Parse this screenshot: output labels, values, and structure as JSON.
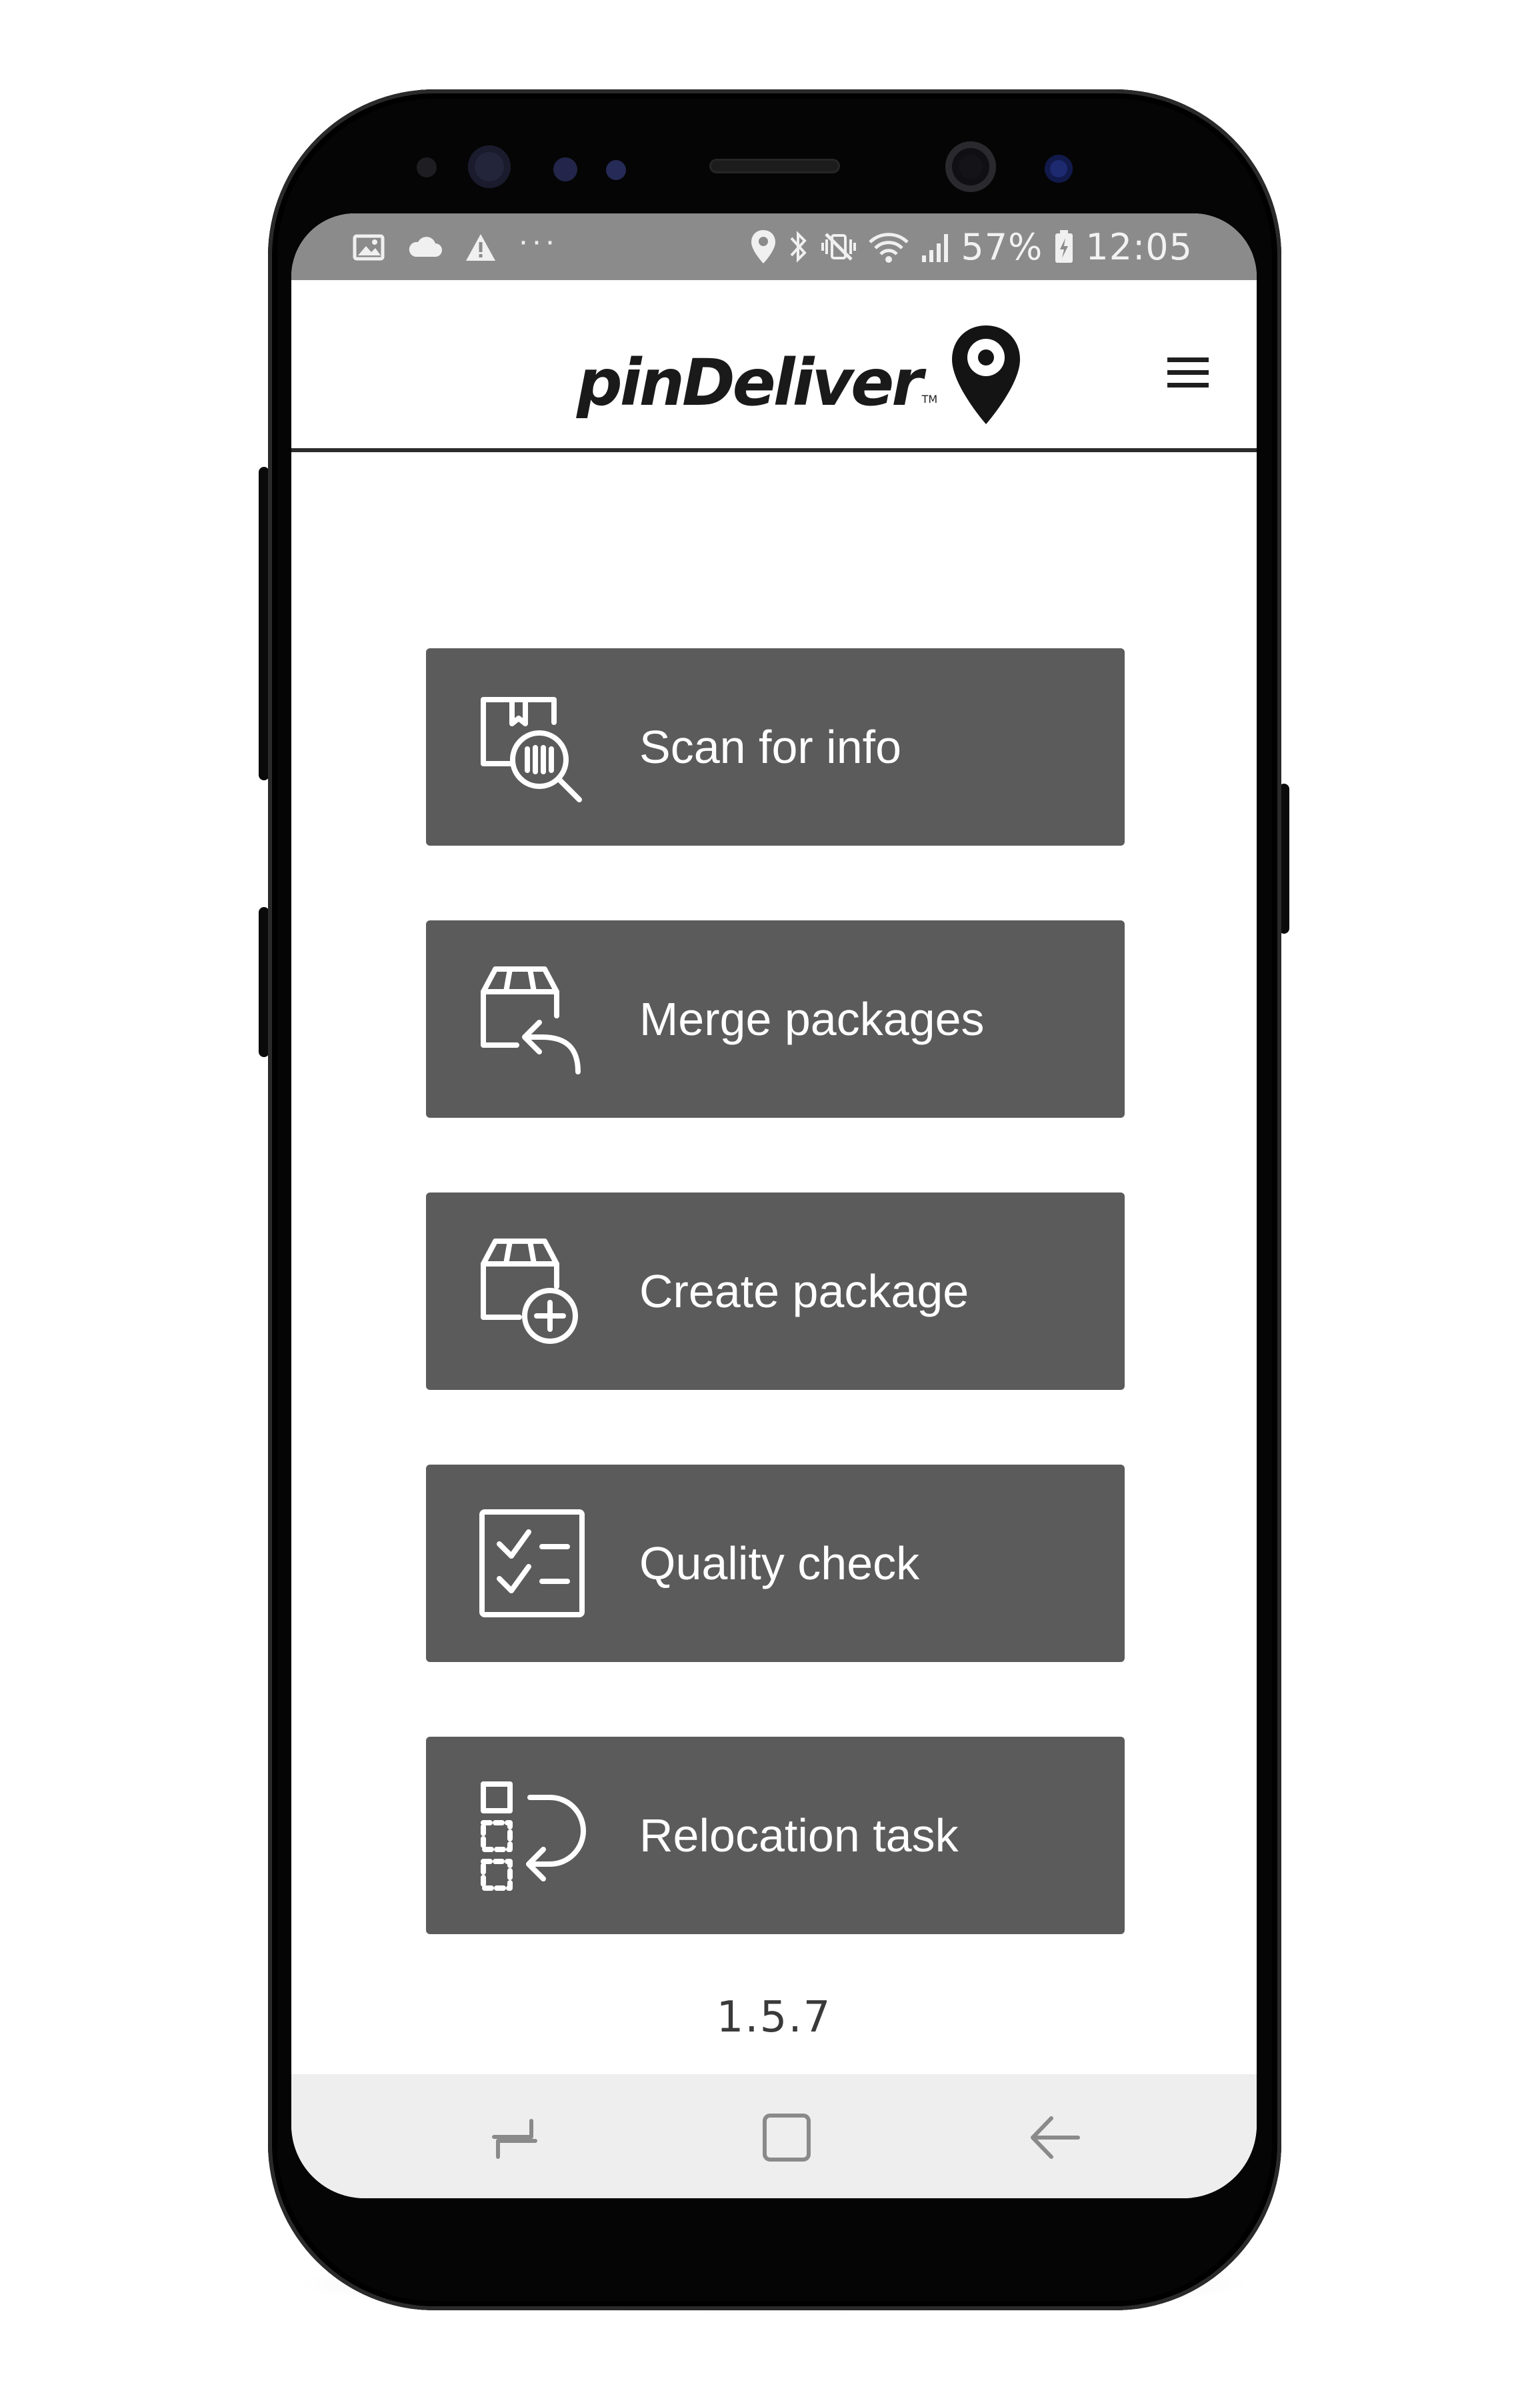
{
  "status_bar": {
    "left_icons": [
      "gallery-icon",
      "cloud-icon",
      "warning-icon",
      "more-notifications-icon"
    ],
    "more_label": "···",
    "right_icons": [
      "location-icon",
      "bluetooth-icon",
      "vibrate-mute-icon",
      "wifi-icon",
      "signal-icon",
      "battery-icon"
    ],
    "battery": "57%",
    "time": "12:05"
  },
  "header": {
    "logo_text": "pinDeliver",
    "logo_tm": "TM",
    "logo_icon": "map-pin-icon",
    "menu_icon": "hamburger-menu-icon"
  },
  "menu": {
    "items": [
      {
        "label": "Scan for info",
        "icon": "scan-package-icon"
      },
      {
        "label": "Merge packages",
        "icon": "merge-packages-icon"
      },
      {
        "label": "Create package",
        "icon": "create-package-icon"
      },
      {
        "label": "Quality check",
        "icon": "checklist-icon"
      },
      {
        "label": "Relocation task",
        "icon": "relocation-icon"
      }
    ],
    "button_color": "#5b5b5b",
    "text_color": "#ffffff"
  },
  "version": "1.5.7",
  "nav_bar": {
    "buttons": [
      "recent-apps-icon",
      "home-icon",
      "back-icon"
    ]
  }
}
